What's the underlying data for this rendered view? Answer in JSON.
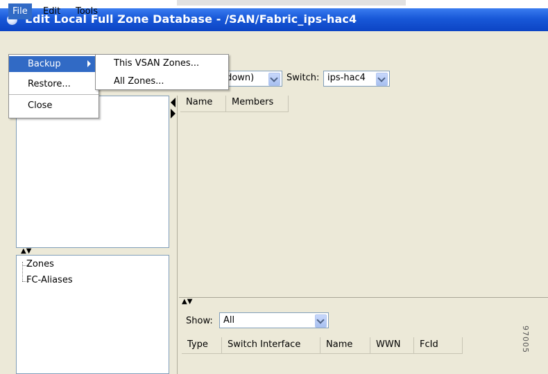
{
  "window": {
    "title": "Edit Local Full Zone Database - /SAN/Fabric_ips-hac4"
  },
  "menubar": {
    "file": "File",
    "edit": "Edit",
    "tools": "Tools"
  },
  "file_menu": {
    "items": [
      "Backup",
      "Restore...",
      "Close"
    ]
  },
  "backup_submenu": {
    "items": [
      "This VSAN Zones...",
      "All Zones..."
    ]
  },
  "toolbar": {
    "vsan_value": "(down)",
    "switch_label": "Switch:",
    "switch_value": "ips-hac4"
  },
  "zones_table": {
    "columns": [
      "Name",
      "Members"
    ]
  },
  "tree": {
    "items": [
      "Zones",
      "FC-Aliases"
    ]
  },
  "bottom_panel": {
    "show_label": "Show:",
    "show_value": "All",
    "columns": [
      "Type",
      "Switch Interface",
      "Name",
      "WWN",
      "FcId"
    ]
  },
  "figure_code": "97005"
}
